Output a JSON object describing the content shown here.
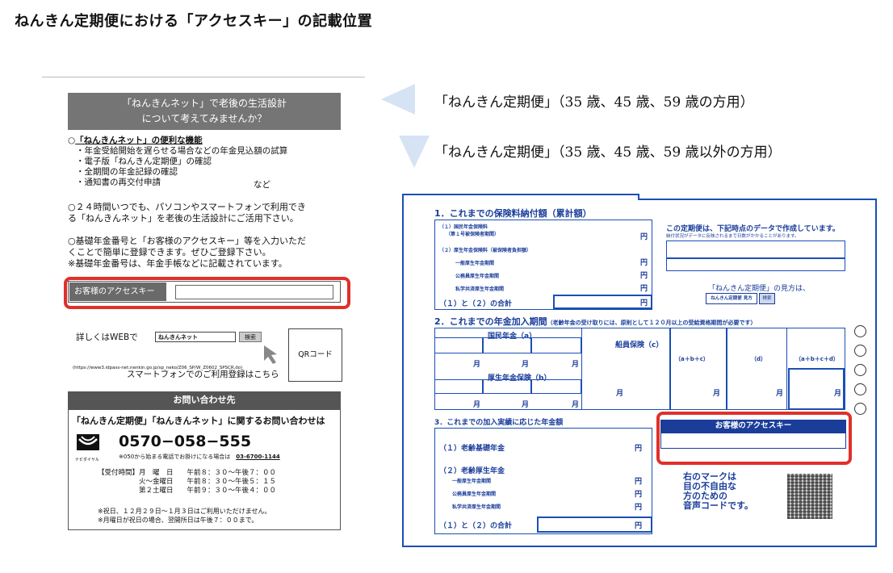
{
  "title": "ねんきん定期便における「アクセスキー」の記載位置",
  "left": {
    "header": [
      "「ねんきんネット」で老後の生活設計",
      "について考えてみませんか？"
    ],
    "features_title": "「ねんきんネット」の便利な機能",
    "features": [
      "・年金受給開始を遅らせる場合などの年金見込額の試算",
      "・電子版「ねんきん定期便」の確認",
      "・全期間の年金記録の確認",
      "・通知書の再交付申請"
    ],
    "features_etc": "など",
    "para2": [
      "○２４時間いつでも、パソコンやスマートフォンで利用でき",
      "る「ねんきんネット」を老後の生活設計にご活用下さい。"
    ],
    "para3": [
      "○基礎年金番号と「お客様のアクセスキー」等を入力いただ",
      "くことで簡単に登録できます。ぜひご登録下さい。",
      "※基礎年金番号は、年金手帳などに記載されています。"
    ],
    "access_key_label": "お客様のアクセスキー",
    "web_label": "詳しくはWEBで",
    "web_search": "ねんきんネット",
    "web_btn": "検索",
    "qr_label": "QRコード",
    "url": "(https://www3.idpass-net.nenkin.go.jp/sp_neko/Z06_SP/W_Z0602_SPSCR.do)",
    "smartphone": "スマートフォンでのご利用登録はこちら",
    "contact_head": "お問い合わせ先",
    "contact_title": "「ねんきん定期便」「ねんきんネット」に関するお問い合わせは",
    "phone": "0570−058−555",
    "phone_note": "※050から始まる電話でお掛けになる場合は",
    "phone_alt": "03-6700-1144",
    "navi": "ナビダイヤル",
    "hours": [
      "【受付時間】月　曜　日　　午前８：３０〜午後７：００",
      "　　　　　　火〜金曜日　　午前８：３０〜午後５：１５",
      "　　　　　　第２土曜日　　午前９：３０〜午後４：００"
    ],
    "notes": [
      "※祝日、１２月２９日〜１月３日はご利用いただけません。",
      "※月曜日が祝日の場合、翌開所日は午後７：００まで。"
    ]
  },
  "legend": [
    {
      "text": "「ねんきん定期便」（35 歳、45 歳、59 歳の方用）",
      "color": "#d9e5f5"
    },
    {
      "text": "「ねんきん定期便」（35 歳、45 歳、59 歳以外の方用）",
      "color": "#d9e5f5"
    }
  ],
  "form": {
    "sec1": "1．これまでの保険料納付額（累計額）",
    "sec1_rows": [
      "（１）国民年金保険料",
      "（第１号被保険者期間）",
      "（２）厚生年金保険料（被保険者負担額）",
      "一般厚生年金期間",
      "公務員厚生年金期間",
      "私学共済厚生年金期間",
      "（１）と（２）の合計"
    ],
    "yen": "円",
    "note_right": "この定期便は、下記時点のデータで作成しています。",
    "note_right_sub": "納付状況がデータに反映されるまで日数がかかることがあります。",
    "mihon": "「ねんきん定期便」の見方は、",
    "mihon_search": "ねんきん定期便 見方",
    "mihon_btn": "検索",
    "sec2": "2．これまでの年金加入期間",
    "sec2_note": "（老齢年金の受け取りには、原則として１２０月以上の受給資格期間が必要です）",
    "kokumin": "国民年金（a）",
    "kosei": "厚生年金保険（b）",
    "senin": "船員保険（c）",
    "abc": "（a＋b＋c）",
    "d": "（d）",
    "abcde": "（a＋b＋c＋d）",
    "month": "月",
    "sec3": "3．これまでの加入実績に応じた年金額",
    "sec3_rows": [
      "（１）老齢基礎年金",
      "（２）老齢厚生年金",
      "一般厚生年金期間",
      "公務員厚生年金期間",
      "私学共済厚生年金期間",
      "（１）と（２）の合計"
    ],
    "access_key_head": "お客様のアクセスキー",
    "voice": [
      "右のマークは",
      "目の不自由な",
      "方のための",
      "音声コードです。"
    ]
  }
}
